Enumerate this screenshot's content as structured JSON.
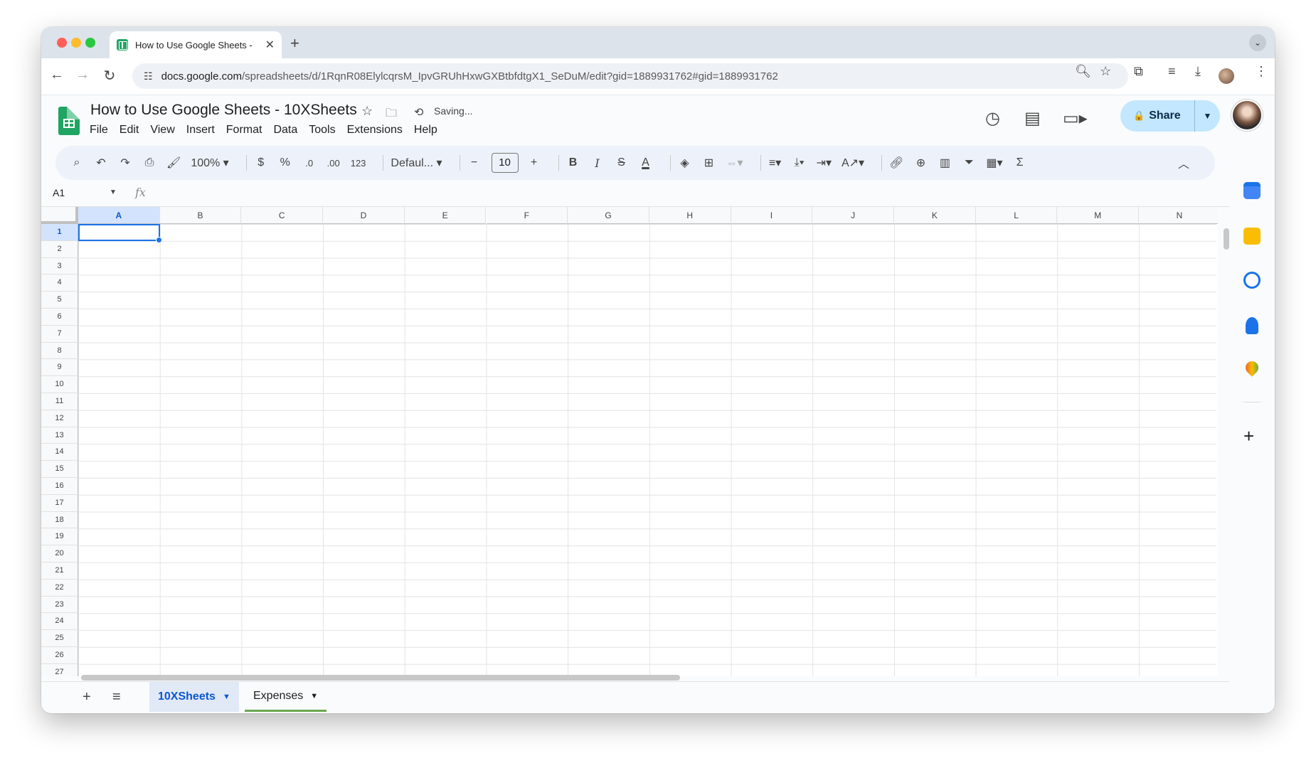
{
  "browser": {
    "tab_title": "How to Use Google Sheets -",
    "url_host": "docs.google.com",
    "url_path": "/spreadsheets/d/1RqnR08ElylcqrsM_IpvGRUhHxwGXBtbfdtgX1_SeDuM/edit?gid=1889931762#gid=1889931762"
  },
  "doc": {
    "title": "How to Use Google Sheets - 10XSheets",
    "status": "Saving...",
    "share_label": "Share",
    "menu": [
      "File",
      "Edit",
      "View",
      "Insert",
      "Format",
      "Data",
      "Tools",
      "Extensions",
      "Help"
    ]
  },
  "toolbar": {
    "zoom": "100%",
    "currency": "$",
    "percent": "%",
    "decrease_decimal": ".0",
    "increase_decimal": ".00",
    "number_format": "123",
    "font": "Defaul...",
    "font_size": "10"
  },
  "formula_bar": {
    "cell_ref": "A1",
    "fx": "fx"
  },
  "grid": {
    "columns": [
      "A",
      "B",
      "C",
      "D",
      "E",
      "F",
      "G",
      "H",
      "I",
      "J",
      "K",
      "L",
      "M",
      "N"
    ],
    "rows": [
      "1",
      "2",
      "3",
      "4",
      "5",
      "6",
      "7",
      "8",
      "9",
      "10",
      "11",
      "12",
      "13",
      "14",
      "15",
      "16",
      "17",
      "18",
      "19",
      "20",
      "21",
      "22",
      "23",
      "24",
      "25",
      "26",
      "27"
    ],
    "selected_col": "A",
    "selected_row": "1"
  },
  "sheets": [
    {
      "label": "10XSheets",
      "active": true
    },
    {
      "label": "Expenses",
      "active": false
    }
  ],
  "side_panel": [
    "calendar-icon",
    "keep-icon",
    "tasks-icon",
    "contacts-icon",
    "maps-icon"
  ]
}
